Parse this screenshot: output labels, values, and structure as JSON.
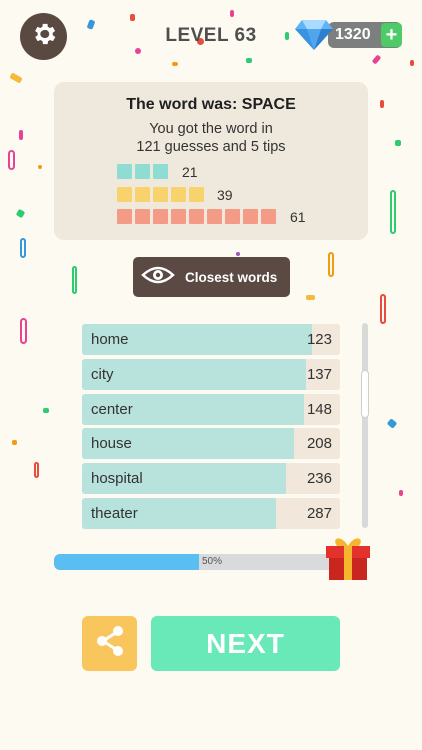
{
  "header": {
    "level": "LEVEL 63",
    "coins": "1320",
    "plus": "+"
  },
  "result": {
    "title": "The word was: SPACE",
    "line1": "You got the word in",
    "line2": "121 guesses and 5 tips",
    "bars": [
      {
        "count": "21",
        "squares": 3,
        "color": "#8fdcd2"
      },
      {
        "count": "39",
        "squares": 5,
        "color": "#f8d36b"
      },
      {
        "count": "61",
        "squares": 9,
        "color": "#f49b88"
      }
    ]
  },
  "closest_button": {
    "label": "Closest words"
  },
  "words": [
    {
      "word": "home",
      "score": "123",
      "closeness": 0.89
    },
    {
      "word": "city",
      "score": "137",
      "closeness": 0.87
    },
    {
      "word": "center",
      "score": "148",
      "closeness": 0.86
    },
    {
      "word": "house",
      "score": "208",
      "closeness": 0.82
    },
    {
      "word": "hospital",
      "score": "236",
      "closeness": 0.79
    },
    {
      "word": "theater",
      "score": "287",
      "closeness": 0.75
    }
  ],
  "progress": {
    "label": "50%",
    "value": 0.5
  },
  "next_button": {
    "label": "NEXT"
  },
  "icons": {
    "settings": "gear-icon",
    "coins": "diamond-icon",
    "closest": "eye-icon",
    "gift": "gift-icon",
    "share": "share-icon"
  },
  "colors": {
    "accent_next": "#69e8b8",
    "share": "#f9c65e",
    "progress": "#5bbef3"
  }
}
